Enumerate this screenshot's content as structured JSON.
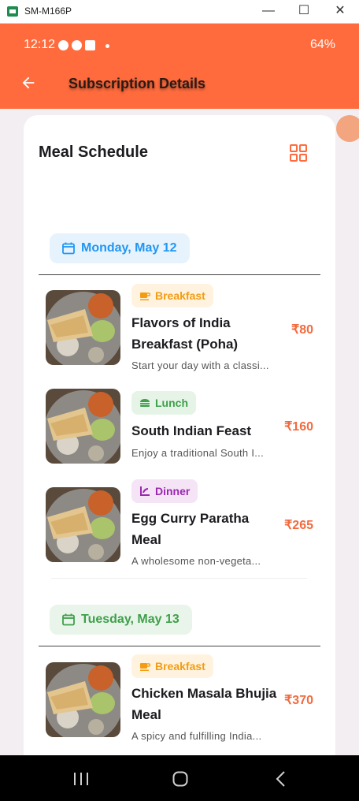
{
  "window": {
    "title": "SM-M166P",
    "minimize": "—",
    "maximize": "☐",
    "close": "✕"
  },
  "status_bar": {
    "time": "12:12",
    "battery": "64%"
  },
  "app_bar": {
    "title": "Subscription Details"
  },
  "schedule": {
    "title": "Meal Schedule",
    "days": [
      {
        "label": "Monday, May 12",
        "color": "#2196f3",
        "bg": "#e6f3fd",
        "meals": [
          {
            "tag": "Breakfast",
            "tag_icon": "coffee-icon",
            "name": "Flavors of India Breakfast (Poha)",
            "desc": "Start your day with a classi...",
            "price": "₹80"
          },
          {
            "tag": "Lunch",
            "tag_icon": "burger-icon",
            "name": "South Indian Feast",
            "desc": "Enjoy a traditional South I...",
            "price": "₹160"
          },
          {
            "tag": "Dinner",
            "tag_icon": "dinner-icon",
            "name": "Egg Curry Paratha Meal",
            "desc": "A wholesome non-vegeta...",
            "price": "₹265"
          }
        ]
      },
      {
        "label": "Tuesday, May 13",
        "color": "#3f9f4b",
        "bg": "#e9f5ea",
        "meals": [
          {
            "tag": "Breakfast",
            "tag_icon": "coffee-icon",
            "name": "Chicken Masala Bhujia Meal",
            "desc": "A spicy and fulfilling India...",
            "price": "₹370"
          }
        ]
      }
    ]
  },
  "tag_colors": {
    "Breakfast": {
      "fg": "#f39c12",
      "bg": "#fff3df"
    },
    "Lunch": {
      "fg": "#3f9f4b",
      "bg": "#e6f4e7"
    },
    "Dinner": {
      "fg": "#9c27b0",
      "bg": "#f4e4f6"
    }
  },
  "accent": "#ff6b3d"
}
